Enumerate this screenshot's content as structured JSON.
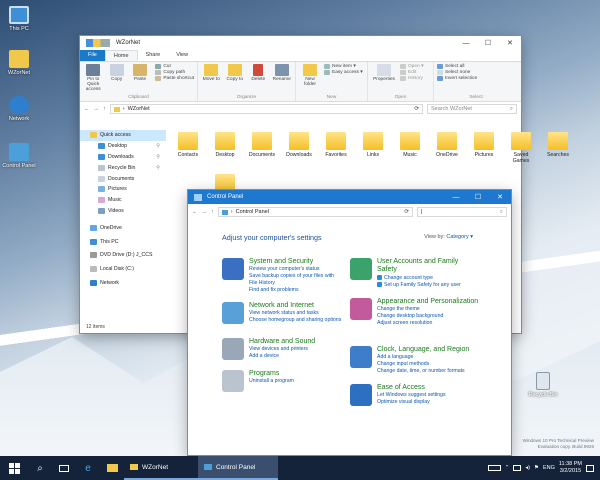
{
  "desktop": {
    "icons": [
      {
        "label": "This PC"
      },
      {
        "label": "WZorNet"
      },
      {
        "label": "Network"
      },
      {
        "label": "Control Panel"
      },
      {
        "label": "Recycle Bin"
      }
    ],
    "watermark": [
      "Windows 10 Pro Technical Preview",
      "Evaluation copy. Build 9926"
    ]
  },
  "explorer": {
    "title": "WZorNet",
    "window_controls": [
      "—",
      "☐",
      "✕"
    ],
    "tabs": [
      "File",
      "Home",
      "Share",
      "View"
    ],
    "ribbon": {
      "clipboard": {
        "name": "Clipboard",
        "pin": "Pin to Quick access",
        "copy": "Copy",
        "paste": "Paste",
        "cut": "Cut",
        "copy_path": "Copy path",
        "paste_shortcut": "Paste shortcut"
      },
      "organize": {
        "name": "Organize",
        "move": "Move to",
        "copy": "Copy to",
        "delete": "Delete",
        "rename": "Rename"
      },
      "new": {
        "name": "New",
        "folder": "New folder",
        "item": "New item ▾",
        "easy": "Easy access ▾"
      },
      "open": {
        "name": "Open",
        "properties": "Properties",
        "open": "Open ▾",
        "edit": "Edit",
        "history": "History"
      },
      "select": {
        "name": "Select",
        "all": "Select all",
        "none": "Select none",
        "invert": "Invert selection"
      }
    },
    "address": {
      "path": "WZorNet",
      "search_placeholder": "Search WZorNet"
    },
    "nav": [
      "Quick access",
      "Desktop",
      "Downloads",
      "Recycle Bin",
      "Documents",
      "Pictures",
      "Music",
      "Videos",
      "OneDrive",
      "This PC",
      "DVD Drive (D:) J_CCS",
      "Local Disk (C:)",
      "Network"
    ],
    "folders": [
      "Contacts",
      "Desktop",
      "Documents",
      "Downloads",
      "Favorites",
      "Links",
      "Music",
      "OneDrive",
      "Pictures",
      "Saved Games",
      "Searches",
      "Videos"
    ],
    "status": "12 items"
  },
  "control_panel": {
    "title": "Control Panel",
    "window_controls": [
      "—",
      "☐",
      "✕"
    ],
    "address": "Control Panel",
    "heading": "Adjust your computer's settings",
    "viewby_label": "View by:",
    "viewby_value": "Category ▾",
    "left": [
      {
        "title": "System and Security",
        "links": [
          "Review your computer's status",
          "Save backup copies of your files with File History",
          "Find and fix problems"
        ]
      },
      {
        "title": "Network and Internet",
        "links": [
          "View network status and tasks",
          "Choose homegroup and sharing options"
        ]
      },
      {
        "title": "Hardware and Sound",
        "links": [
          "View devices and printers",
          "Add a device"
        ]
      },
      {
        "title": "Programs",
        "links": [
          "Uninstall a program"
        ]
      }
    ],
    "right": [
      {
        "title": "User Accounts and Family Safety",
        "links": [
          "Change account type",
          "Set up Family Safety for any user"
        ]
      },
      {
        "title": "Appearance and Personalization",
        "links": [
          "Change the theme",
          "Change desktop background",
          "Adjust screen resolution"
        ]
      },
      {
        "title": "Clock, Language, and Region",
        "links": [
          "Add a language",
          "Change input methods",
          "Change date, time, or number formats"
        ]
      },
      {
        "title": "Ease of Access",
        "links": [
          "Let Windows suggest settings",
          "Optimize visual display"
        ]
      }
    ]
  },
  "taskbar": {
    "apps": [
      "WZorNet",
      "Control Panel"
    ],
    "lang": "ENG",
    "time": "11:38 PM",
    "date": "3/2/2015"
  },
  "colors": {
    "accent": "#1979ca",
    "link": "#0b57b8",
    "category": "#1a7a1a",
    "folder": "#f6bf26"
  }
}
